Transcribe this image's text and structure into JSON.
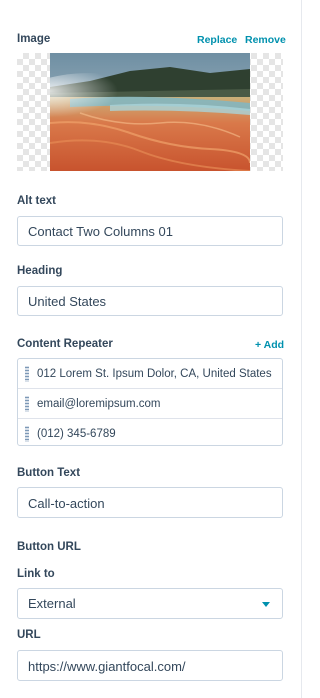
{
  "image_section": {
    "label": "Image",
    "replace_label": "Replace",
    "remove_label": "Remove"
  },
  "alt_text": {
    "label": "Alt text",
    "value": "Contact Two Columns 01"
  },
  "heading": {
    "label": "Heading",
    "value": "United States"
  },
  "content_repeater": {
    "label": "Content Repeater",
    "add_label": "+ Add",
    "items": [
      "012 Lorem St. Ipsum Dolor, CA, United States",
      "email@loremipsum.com",
      "(012) 345-6789"
    ]
  },
  "button_text": {
    "label": "Button Text",
    "value": "Call-to-action"
  },
  "button_url": {
    "label": "Button URL",
    "link_to_label": "Link to",
    "link_to_value": "External",
    "url_label": "URL",
    "url_value": "https://www.giantfocal.com/"
  },
  "colors": {
    "accent": "#0091ae",
    "text": "#33475b",
    "border": "#cbd6e2"
  }
}
